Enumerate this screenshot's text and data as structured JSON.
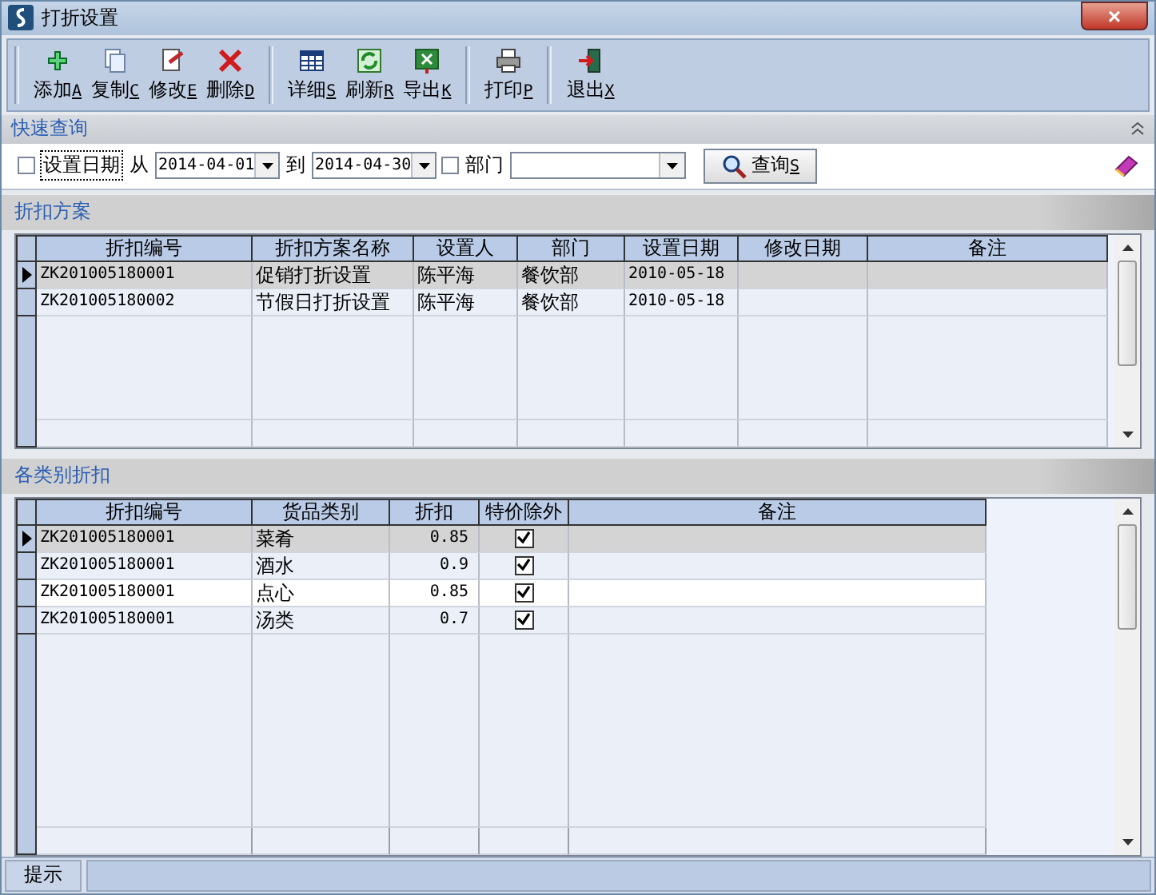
{
  "window": {
    "title": "打折设置",
    "close": "×"
  },
  "toolbar": [
    [
      {
        "kind": "add",
        "label": "添加",
        "key": "A"
      },
      {
        "kind": "copy",
        "label": "复制",
        "key": "C"
      },
      {
        "kind": "edit",
        "label": "修改",
        "key": "E"
      },
      {
        "kind": "delete",
        "label": "删除",
        "key": "D"
      }
    ],
    [
      {
        "kind": "grid",
        "label": "详细",
        "key": "S"
      },
      {
        "kind": "refresh",
        "label": "刷新",
        "key": "R"
      },
      {
        "kind": "export",
        "label": "导出",
        "key": "K"
      }
    ],
    [
      {
        "kind": "print",
        "label": "打印",
        "key": "P"
      }
    ],
    [
      {
        "kind": "exit",
        "label": "退出",
        "key": "X"
      }
    ]
  ],
  "quick_search": {
    "title": "快速查询",
    "date_filter": {
      "label": "设置日期",
      "checked": false
    },
    "from_label": "从",
    "from": "2014-04-01",
    "to_label": "到",
    "to": "2014-04-30",
    "dept_filter": {
      "label": "部门",
      "checked": false
    },
    "search_button": {
      "label": "查询",
      "key": "S"
    }
  },
  "schemes": {
    "title": "折扣方案",
    "columns": [
      "折扣编号",
      "折扣方案名称",
      "设置人",
      "部门",
      "设置日期",
      "修改日期",
      "备注"
    ],
    "rows": [
      {
        "selected": true,
        "cells": [
          "ZK201005180001",
          "促销打折设置",
          "陈平海",
          "餐饮部",
          "2010-05-18",
          "",
          ""
        ]
      },
      {
        "selected": false,
        "cells": [
          "ZK201005180002",
          "节假日打折设置",
          "陈平海",
          "餐饮部",
          "2010-05-18",
          "",
          ""
        ]
      }
    ]
  },
  "categories": {
    "title": "各类别折扣",
    "columns": [
      "折扣编号",
      "货品类别",
      "折扣",
      "特价除外",
      "备注"
    ],
    "rows": [
      {
        "selected": true,
        "id": "ZK201005180001",
        "category": "菜肴",
        "discount": "0.85",
        "exclude_special": true
      },
      {
        "selected": false,
        "id": "ZK201005180001",
        "category": "酒水",
        "discount": "0.9",
        "exclude_special": true
      },
      {
        "selected": false,
        "id": "ZK201005180001",
        "category": "点心",
        "discount": "0.85",
        "exclude_special": true
      },
      {
        "selected": false,
        "id": "ZK201005180001",
        "category": "汤类",
        "discount": "0.7",
        "exclude_special": true
      }
    ]
  },
  "status_bar": {
    "label": "提示"
  }
}
